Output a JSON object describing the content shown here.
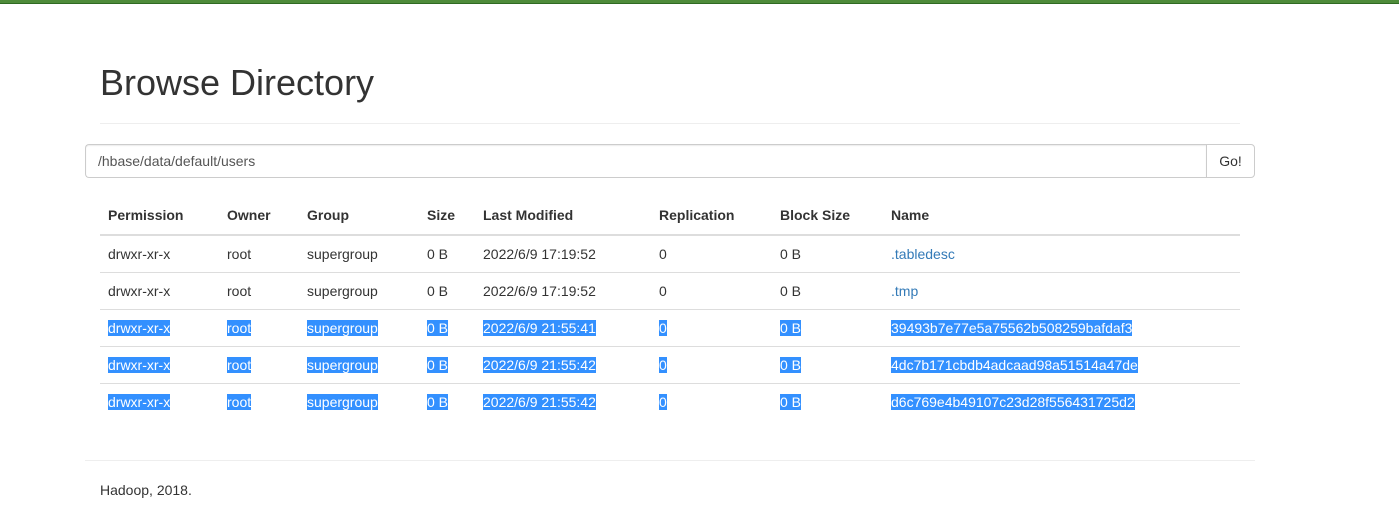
{
  "colors": {
    "top_bar": "#4e8b3a",
    "link": "#337ab7",
    "selection": "#3390ff"
  },
  "page": {
    "title": "Browse Directory"
  },
  "path_form": {
    "value": "/hbase/data/default/users",
    "go_label": "Go!"
  },
  "table": {
    "headers": {
      "permission": "Permission",
      "owner": "Owner",
      "group": "Group",
      "size": "Size",
      "last_modified": "Last Modified",
      "replication": "Replication",
      "block_size": "Block Size",
      "name": "Name"
    },
    "rows": [
      {
        "permission": "drwxr-xr-x",
        "owner": "root",
        "group": "supergroup",
        "size": "0 B",
        "last_modified": "2022/6/9 17:19:52",
        "replication": "0",
        "block_size": "0 B",
        "name": ".tabledesc",
        "selected": false
      },
      {
        "permission": "drwxr-xr-x",
        "owner": "root",
        "group": "supergroup",
        "size": "0 B",
        "last_modified": "2022/6/9 17:19:52",
        "replication": "0",
        "block_size": "0 B",
        "name": ".tmp",
        "selected": false
      },
      {
        "permission": "drwxr-xr-x",
        "owner": "root",
        "group": "supergroup",
        "size": "0 B",
        "last_modified": "2022/6/9 21:55:41",
        "replication": "0",
        "block_size": "0 B",
        "name": "39493b7e77e5a75562b508259bafdaf3",
        "selected": true
      },
      {
        "permission": "drwxr-xr-x",
        "owner": "root",
        "group": "supergroup",
        "size": "0 B",
        "last_modified": "2022/6/9 21:55:42",
        "replication": "0",
        "block_size": "0 B",
        "name": "4dc7b171cbdb4adcaad98a51514a47de",
        "selected": true
      },
      {
        "permission": "drwxr-xr-x",
        "owner": "root",
        "group": "supergroup",
        "size": "0 B",
        "last_modified": "2022/6/9 21:55:42",
        "replication": "0",
        "block_size": "0 B",
        "name": "d6c769e4b49107c23d28f556431725d2",
        "selected": true
      }
    ]
  },
  "footer": {
    "text": "Hadoop, 2018."
  }
}
